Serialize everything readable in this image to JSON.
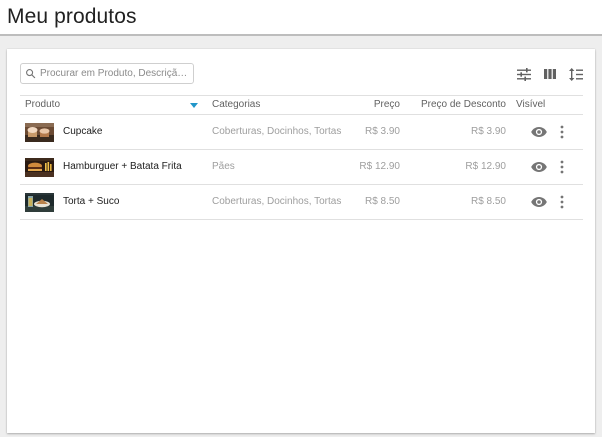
{
  "page": {
    "title": "Meu produtos"
  },
  "search": {
    "placeholder": "Procurar em Produto, Descrição, ...",
    "value": ""
  },
  "toolbar": {
    "icons": [
      "filter-sliders-icon",
      "view-columns-icon",
      "sort-list-icon"
    ]
  },
  "table": {
    "columns": {
      "product": "Produto",
      "categories": "Categorias",
      "price": "Preço",
      "discount_price": "Preço de Desconto",
      "visible": "Visível"
    },
    "rows": [
      {
        "name": "Cupcake",
        "categories": "Coberturas, Docinhos, Tortas",
        "price": "R$ 3.90",
        "discount_price": "R$ 3.90",
        "thumb": "cupcake-photo"
      },
      {
        "name": "Hamburguer + Batata Frita",
        "categories": "Pães",
        "price": "R$ 12.90",
        "discount_price": "R$ 12.90",
        "thumb": "burger-photo"
      },
      {
        "name": "Torta + Suco",
        "categories": "Coberturas, Docinhos, Tortas",
        "price": "R$ 8.50",
        "discount_price": "R$ 8.50",
        "thumb": "pie-photo"
      }
    ]
  },
  "colors": {
    "accent": "#2196c9",
    "icon": "#616161",
    "muted_text": "#9e9e9e",
    "divider": "#e0e0e0"
  }
}
